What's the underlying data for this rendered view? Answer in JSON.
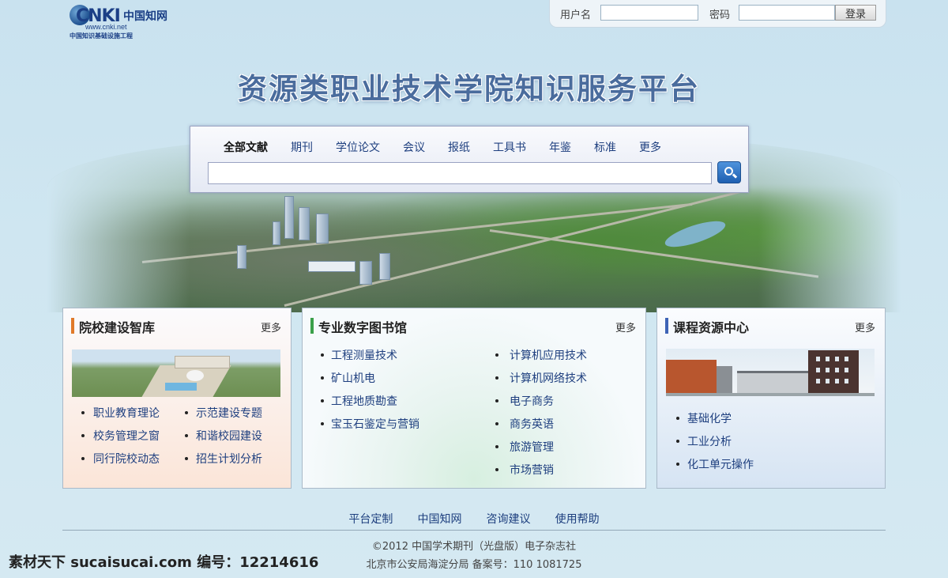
{
  "logo": {
    "brand": "CNKI",
    "cn": "中国知网",
    "url": "www.cnki.net",
    "subtitle": "中国知识基础设施工程"
  },
  "login": {
    "username_label": "用户名",
    "password_label": "密码",
    "username_value": "",
    "password_value": "",
    "submit_label": "登录"
  },
  "page_title": "资源类职业技术学院知识服务平台",
  "search": {
    "tabs": [
      {
        "label": "全部文献",
        "active": true
      },
      {
        "label": "期刊"
      },
      {
        "label": "学位论文"
      },
      {
        "label": "会议"
      },
      {
        "label": "报纸"
      },
      {
        "label": "工具书"
      },
      {
        "label": "年鉴"
      },
      {
        "label": "标准"
      },
      {
        "label": "更多"
      }
    ],
    "query": ""
  },
  "panels": {
    "think_tank": {
      "title": "院校建设智库",
      "more": "更多",
      "links": [
        "职业教育理论",
        "示范建设专题",
        "校务管理之窗",
        "和谐校园建设",
        "同行院校动态",
        "招生计划分析"
      ]
    },
    "library": {
      "title": "专业数字图书馆",
      "more": "更多",
      "links_left": [
        "工程测量技术",
        "矿山机电",
        "工程地质勘查",
        "宝玉石鉴定与营销"
      ],
      "links_right": [
        "计算机应用技术",
        "计算机网络技术",
        "电子商务",
        "商务英语",
        "旅游管理",
        "市场营销"
      ]
    },
    "courses": {
      "title": "课程资源中心",
      "more": "更多",
      "links": [
        "基础化学",
        "工业分析",
        "化工单元操作"
      ]
    }
  },
  "footer": {
    "nav": [
      "平台定制",
      "中国知网",
      "咨询建议",
      "使用帮助"
    ],
    "copyright": "©2012  中国学术期刊（光盘版）电子杂志社",
    "icp": "北京市公安局海淀分局  备案号：110  1081725",
    "watermark": "素材天下 sucaisucai.com   编号：12214616"
  }
}
